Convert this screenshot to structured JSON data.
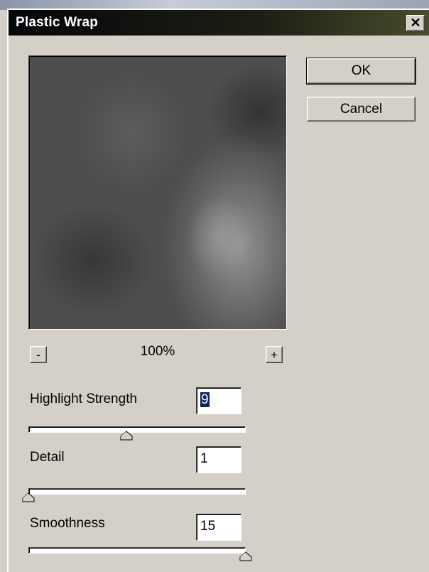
{
  "dialog": {
    "title": "Plastic Wrap",
    "close_glyph": "✕"
  },
  "buttons": {
    "ok_label": "OK",
    "cancel_label": "Cancel"
  },
  "preview": {
    "zoom_out_label": "-",
    "zoom_in_label": "+",
    "zoom_level": "100%"
  },
  "params": [
    {
      "label": "Highlight Strength",
      "value": "9",
      "selected": true,
      "slider_level": 0.45
    },
    {
      "label": "Detail",
      "value": "1",
      "selected": false,
      "slider_level": 0.0
    },
    {
      "label": "Smoothness",
      "value": "15",
      "selected": false,
      "slider_level": 1.0
    }
  ]
}
